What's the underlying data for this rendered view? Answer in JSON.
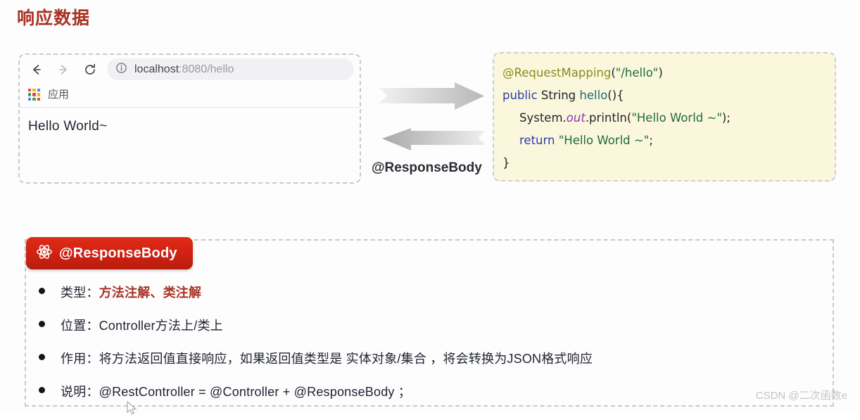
{
  "page": {
    "title": "响应数据",
    "title_color": "#a83224",
    "background": "#fdfdfd"
  },
  "browser": {
    "nav": {
      "back_icon": "arrow-left-icon",
      "forward_icon": "arrow-right-icon",
      "reload_icon": "reload-icon"
    },
    "url_bar": {
      "info_icon": "info-circle-icon",
      "host": "localhost",
      "path": ":8080/hello",
      "full_url": "localhost:8080/hello"
    },
    "bookmarks": {
      "apps_icon": "apps-grid-icon",
      "apps_label": "应用",
      "apps_colors": [
        "#e8453c",
        "#f5b400",
        "#4285f4",
        "#34a853",
        "#e8453c",
        "#f5b400",
        "#4285f4",
        "#34a853",
        "#e8453c"
      ]
    },
    "content": "Hello World~"
  },
  "arrows": {
    "right_icon": "arrow-right-wide-icon",
    "left_icon": "arrow-left-wide-icon",
    "label": "@ResponseBody"
  },
  "code": {
    "background": "#fbf7dd",
    "lines": [
      {
        "indent": 0,
        "tokens": [
          {
            "t": "@RequestMapping",
            "c": "anno"
          },
          {
            "t": "(",
            "c": "punct"
          },
          {
            "t": "\"/hello\"",
            "c": "str"
          },
          {
            "t": ")",
            "c": "punct"
          }
        ]
      },
      {
        "indent": 0,
        "tokens": [
          {
            "t": "public",
            "c": "kw"
          },
          {
            "t": " String ",
            "c": "type"
          },
          {
            "t": "hello",
            "c": "fn"
          },
          {
            "t": "(){",
            "c": "punct"
          }
        ]
      },
      {
        "indent": 1,
        "tokens": [
          {
            "t": "System.",
            "c": "type"
          },
          {
            "t": "out",
            "c": "field"
          },
          {
            "t": ".println(",
            "c": "type"
          },
          {
            "t": "\"Hello World ~\"",
            "c": "str"
          },
          {
            "t": ");",
            "c": "punct"
          }
        ]
      },
      {
        "indent": 1,
        "tokens": [
          {
            "t": "return",
            "c": "kw"
          },
          {
            "t": " ",
            "c": "punct"
          },
          {
            "t": "\"Hello World ~\"",
            "c": "str"
          },
          {
            "t": ";",
            "c": "punct"
          }
        ]
      },
      {
        "indent": 0,
        "tokens": [
          {
            "t": "}",
            "c": "punct"
          }
        ]
      }
    ]
  },
  "info": {
    "badge": {
      "icon": "atom-icon",
      "label": "@ResponseBody",
      "color": "#cf2112"
    },
    "bullets": [
      {
        "label": "类型：",
        "value": "方法注解、类注解",
        "emphasis": true
      },
      {
        "label": "位置：",
        "value": "Controller方法上/类上",
        "emphasis": false
      },
      {
        "label": "作用：",
        "value": "将方法返回值直接响应，如果返回值类型是 实体对象/集合 ，将会转换为JSON格式响应",
        "emphasis": false
      },
      {
        "label": "说明：",
        "value": "@RestController = @Controller + @ResponseBody ；",
        "emphasis": false
      }
    ]
  },
  "watermark": "CSDN @二次函数e"
}
